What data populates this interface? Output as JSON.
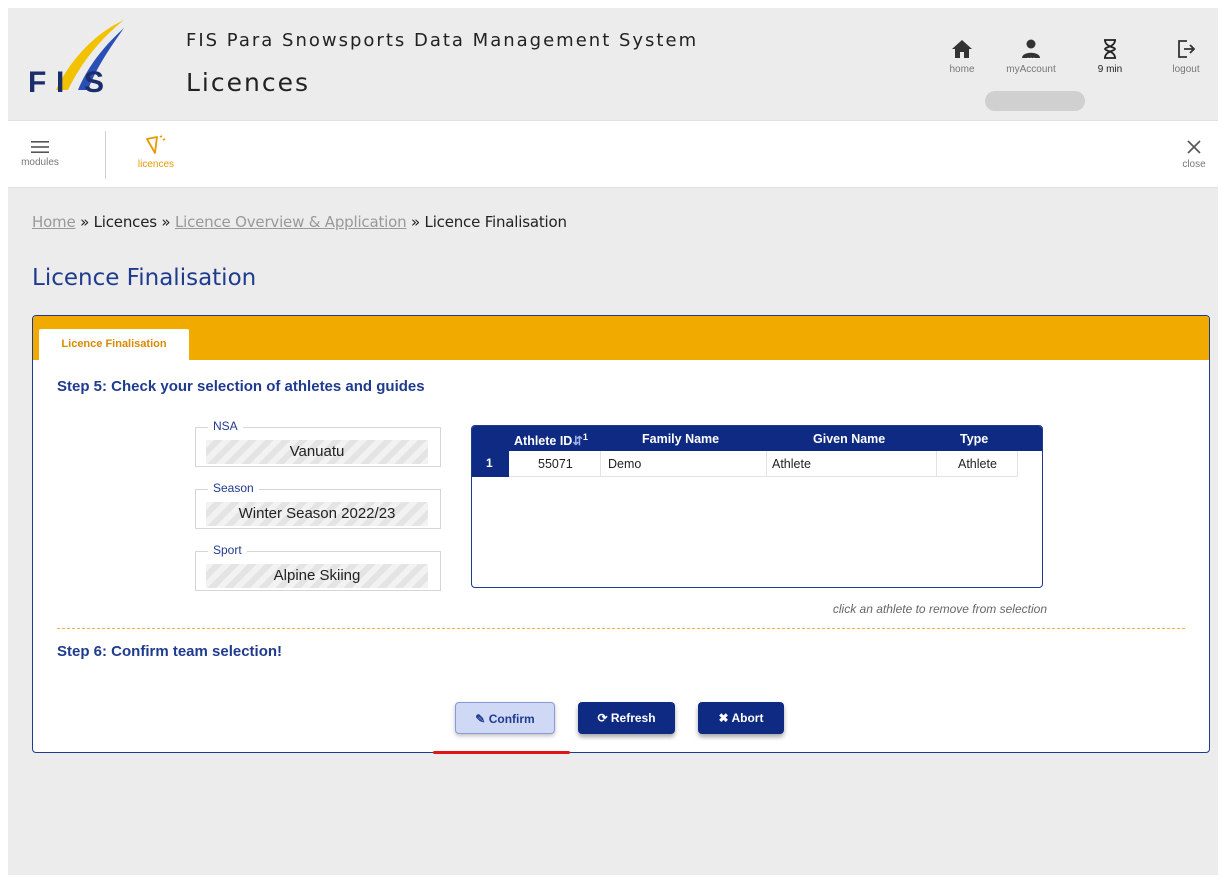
{
  "header": {
    "system_title": "FIS Para Snowsports Data Management System",
    "module_title": "Licences",
    "logo_text": "F/S",
    "nav": {
      "home": {
        "label": "home",
        "icon": "home-icon"
      },
      "account": {
        "label": "myAccount",
        "icon": "user-icon"
      },
      "timer": {
        "label": "9 min",
        "icon": "hourglass-icon"
      },
      "logout": {
        "label": "logout",
        "icon": "logout-icon"
      }
    }
  },
  "toolbar": {
    "modules_label": "modules",
    "licences_label": "licences",
    "close_label": "close",
    "accent_color": "#e69a00"
  },
  "breadcrumb": {
    "home": "Home",
    "sep": "»",
    "licences": "Licences",
    "overview": "Licence Overview & Application",
    "current": "Licence Finalisation"
  },
  "page_title": "Licence Finalisation",
  "tab_label": "Licence Finalisation",
  "step5": {
    "title": "Step 5: Check your selection of athletes and guides",
    "fields": {
      "nsa": {
        "label": "NSA",
        "value": "Vanuatu"
      },
      "season": {
        "label": "Season",
        "value": "Winter Season 2022/23"
      },
      "sport": {
        "label": "Sport",
        "value": "Alpine Skiing"
      }
    },
    "table": {
      "columns": {
        "id": "Athlete ID",
        "sort_indicator": "1",
        "family": "Family Name",
        "given": "Given Name",
        "type": "Type"
      },
      "rows": [
        {
          "num": "1",
          "id": "55071",
          "family": "Demo",
          "given": "Athlete",
          "type": "Athlete"
        }
      ]
    },
    "hint": "click an athlete to remove from selection"
  },
  "step6": {
    "title": "Step 6: Confirm team selection!"
  },
  "buttons": {
    "confirm": "Confirm",
    "refresh": "Refresh",
    "abort": "Abort"
  },
  "colors": {
    "brand_blue": "#0f2a82",
    "accent_orange": "#f0aa00",
    "highlight_red": "#e01515"
  }
}
